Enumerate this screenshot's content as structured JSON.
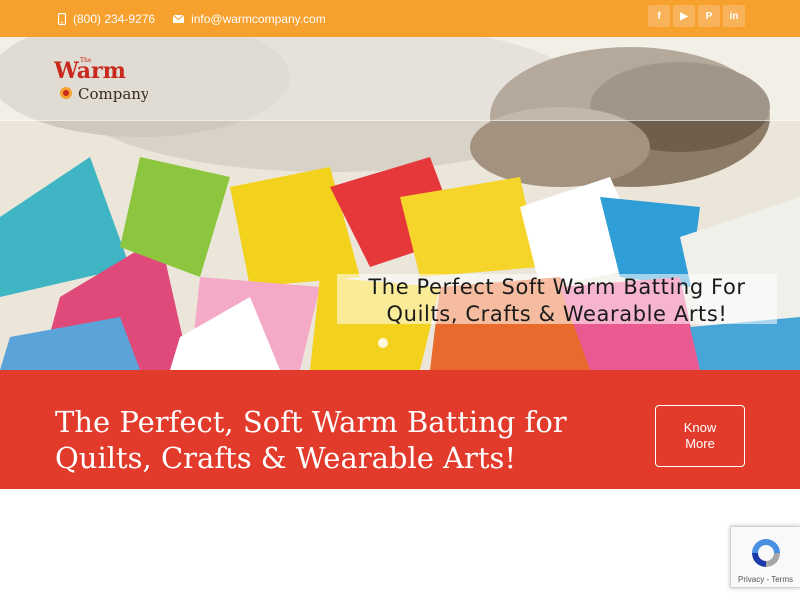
{
  "topbar": {
    "phone": "(800) 234-9276",
    "email": "info@warmcompany.com",
    "social": [
      {
        "name": "facebook-icon",
        "glyph": "f"
      },
      {
        "name": "youtube-icon",
        "glyph": "▶"
      },
      {
        "name": "pinterest-icon",
        "glyph": "P"
      },
      {
        "name": "linkedin-icon",
        "glyph": "in"
      }
    ]
  },
  "logo": {
    "the": "The",
    "warm": "Warm",
    "company": "Company"
  },
  "hero": {
    "caption_line1": "The Perfect Soft Warm Batting For",
    "caption_line2": "Quilts, Crafts & Wearable Arts!"
  },
  "cta": {
    "title_line1": "The Perfect, Soft Warm Batting for",
    "title_line2": "Quilts, Crafts & Wearable Arts!",
    "button_line1": "Know",
    "button_line2": "More"
  },
  "recaptcha": {
    "label": "Privacy - Terms"
  },
  "colors": {
    "topbar": "#f6a02e",
    "cta": "#e23a2b",
    "logo_red": "#c8281e"
  }
}
